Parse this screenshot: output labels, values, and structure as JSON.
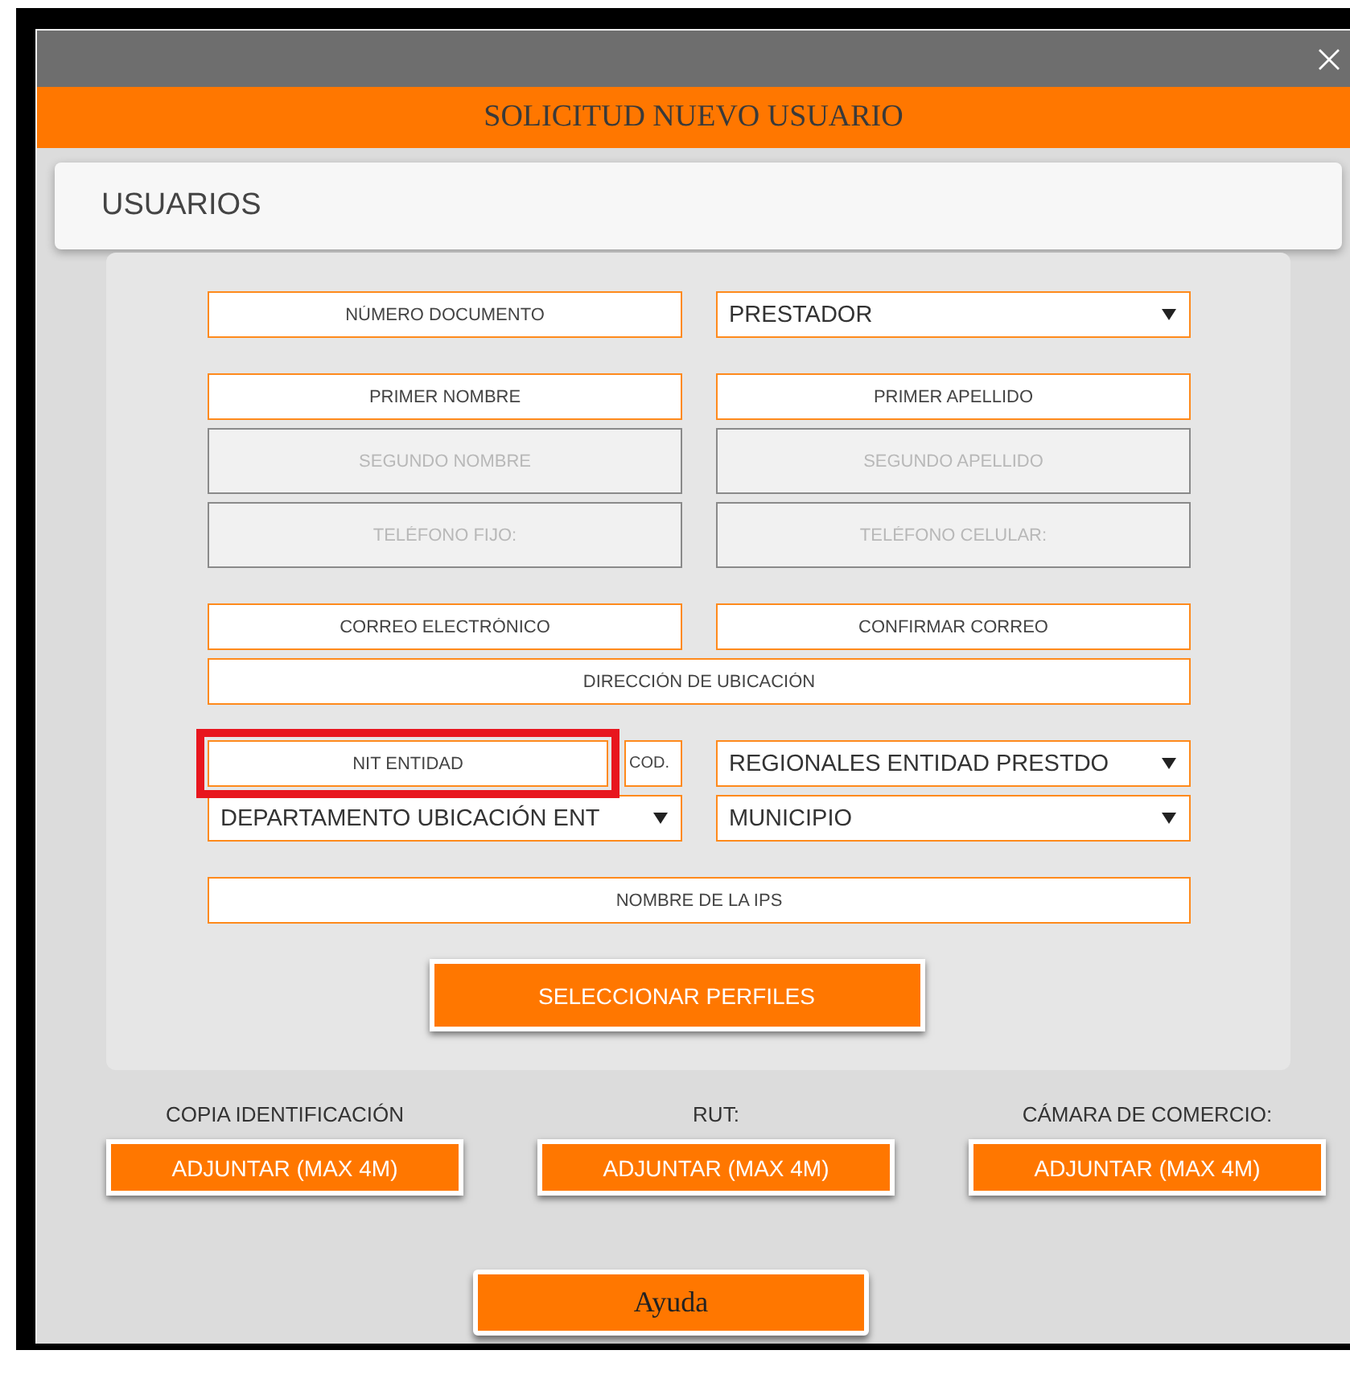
{
  "window": {
    "title": "SOLICITUD NUEVO USUARIO"
  },
  "section": {
    "title": "USUARIOS"
  },
  "groups": [
    {
      "rows": [
        {
          "fields": [
            {
              "kind": "text",
              "placeholder": "NÚMERO DOCUMENTO"
            },
            {
              "kind": "select",
              "value": "PRESTADOR"
            }
          ]
        }
      ]
    },
    {
      "rows": [
        {
          "fields": [
            {
              "kind": "text",
              "placeholder": "PRIMER NOMBRE"
            },
            {
              "kind": "text",
              "placeholder": "PRIMER APELLIDO"
            }
          ]
        },
        {
          "fields": [
            {
              "kind": "disabled",
              "placeholder": "SEGUNDO NOMBRE"
            },
            {
              "kind": "disabled",
              "placeholder": "SEGUNDO APELLIDO"
            }
          ]
        },
        {
          "fields": [
            {
              "kind": "disabled",
              "placeholder": "TELÉFONO FIJO:"
            },
            {
              "kind": "disabled",
              "placeholder": "TELÉFONO CELULAR:"
            }
          ]
        }
      ]
    },
    {
      "rows": [
        {
          "fields": [
            {
              "kind": "text",
              "placeholder": "CORREO ELECTRÓNICO"
            },
            {
              "kind": "text",
              "placeholder": "CONFIRMAR CORREO"
            }
          ]
        },
        {
          "fields": [
            {
              "kind": "text",
              "placeholder": "DIRECCIÓN DE UBICACIÓN"
            }
          ]
        }
      ]
    },
    {
      "rows": [
        {
          "fields": [
            {
              "kind": "text",
              "placeholder": "NIT ENTIDAD",
              "highlighted": true,
              "code_placeholder": "COD."
            },
            {
              "kind": "select",
              "value": "REGIONALES ENTIDAD PRESTDO"
            }
          ]
        },
        {
          "fields": [
            {
              "kind": "select",
              "value": "DEPARTAMENTO UBICACIÓN ENT"
            },
            {
              "kind": "select",
              "value": "MUNICIPIO"
            }
          ]
        }
      ]
    },
    {
      "rows": [
        {
          "fields": [
            {
              "kind": "text",
              "placeholder": "NOMBRE DE LA IPS"
            }
          ]
        }
      ]
    }
  ],
  "profiles_button": "SELECCIONAR PERFILES",
  "attachments": [
    {
      "label": "COPIA IDENTIFICACIÓN",
      "button": "ADJUNTAR (MAX 4M)"
    },
    {
      "label": "RUT:",
      "button": "ADJUNTAR (MAX 4M)"
    },
    {
      "label": "CÁMARA DE COMERCIO:",
      "button": "ADJUNTAR (MAX 4M)"
    }
  ],
  "help_button": "Ayuda"
}
